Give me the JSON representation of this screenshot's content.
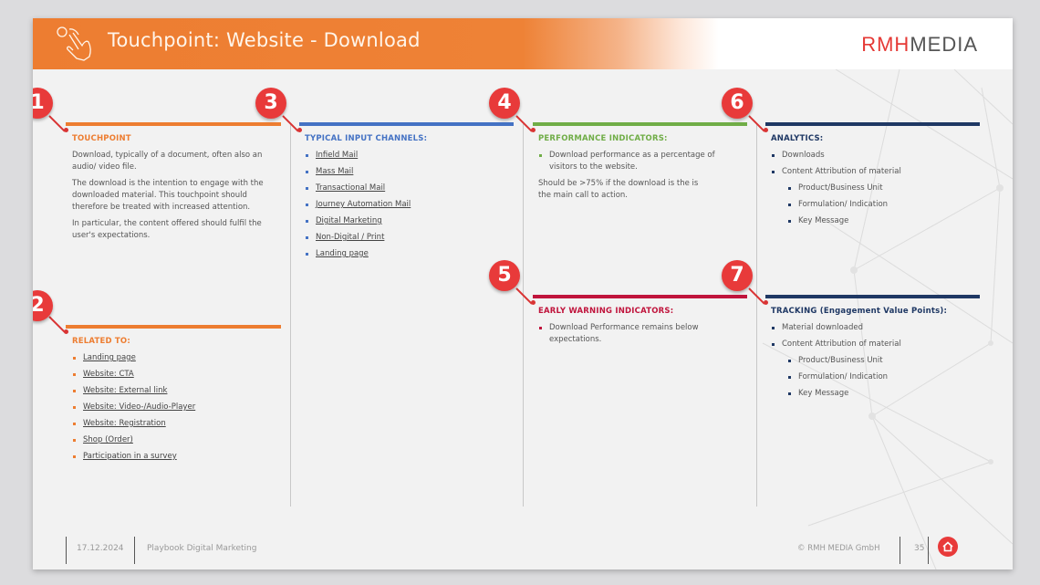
{
  "header": {
    "title": "Touchpoint: Website - Download",
    "icon": "hand-pointer-icon",
    "logo_part1": "RMH",
    "logo_part2": "MEDIA"
  },
  "colors": {
    "orange": "#ed7d31",
    "blue": "#4472c4",
    "green": "#70ad47",
    "crimson": "#c0143c",
    "navy": "#1f3864",
    "badge_red": "#e83a3a"
  },
  "sections": {
    "touchpoint": {
      "badge": "1",
      "heading": "TOUCHPOINT",
      "paragraphs": [
        "Download, typically of a document, often also an audio/ video file.",
        "The download is the intention to engage with the downloaded material. This touchpoint should therefore be treated with increased attention.",
        "In particular, the content offered should fulfil the user's expectations."
      ]
    },
    "related": {
      "badge": "2",
      "heading": "RELATED TO:",
      "items": [
        "Landing page",
        "Website: CTA",
        "Website: External link",
        "Website: Video-/Audio-Player",
        "Website: Registration",
        "Shop (Order)",
        "Participation in a survey"
      ]
    },
    "channels": {
      "badge": "3",
      "heading": "TYPICAL INPUT CHANNELS:",
      "items": [
        "Infield Mail",
        "Mass Mail",
        "Transactional Mail",
        "Journey Automation Mail",
        "Digital Marketing",
        "Non-Digital / Print",
        "Landing page"
      ]
    },
    "performance": {
      "badge": "4",
      "heading": "PERFORMANCE INDICATORS:",
      "items": [
        "Download performance as a percentage of visitors to the website."
      ],
      "note": "Should be >75% if the download is the is the main call to action."
    },
    "warning": {
      "badge": "5",
      "heading": "EARLY WARNING INDICATORS:",
      "items": [
        "Download Performance remains below expectations."
      ]
    },
    "analytics": {
      "badge": "6",
      "heading": "ANALYTICS:",
      "items": [
        "Downloads",
        "Content Attribution of material"
      ],
      "subitems": [
        "Product/Business Unit",
        "Formulation/ Indication",
        "Key Message"
      ]
    },
    "tracking": {
      "badge": "7",
      "heading": "TRACKING (Engagement Value Points):",
      "items": [
        "Material downloaded",
        "Content Attribution of material"
      ],
      "subitems": [
        "Product/Business Unit",
        "Formulation/ Indication",
        "Key Message"
      ]
    }
  },
  "footer": {
    "date": "17.12.2024",
    "title": "Playbook Digital Marketing",
    "copyright": "© RMH MEDIA GmbH",
    "page": "35",
    "home_icon": "home-icon"
  }
}
